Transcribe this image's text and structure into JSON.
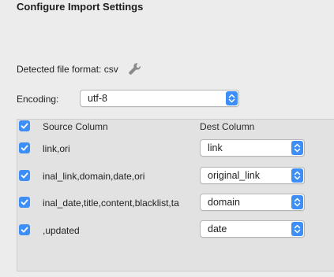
{
  "header": {
    "title": "Configure Import Settings"
  },
  "format": {
    "label": "Detected file format: csv",
    "icon": "wrench-icon"
  },
  "encoding": {
    "label": "Encoding:",
    "value": "utf-8"
  },
  "table": {
    "headers": {
      "source": "Source Column",
      "dest": "Dest Column"
    },
    "select_all_checked": true,
    "rows": [
      {
        "source": "link,ori",
        "dest": "link",
        "checked": true
      },
      {
        "source": "inal_link,domain,date,ori",
        "dest": "original_link",
        "checked": true
      },
      {
        "source": "inal_date,title,content,blacklist,ta",
        "dest": "domain",
        "checked": true
      },
      {
        "source": ",updated",
        "dest": "date",
        "checked": true
      }
    ]
  },
  "colors": {
    "accent": "#3d8ff7",
    "panel_bg": "#e2e2e2",
    "window_bg": "#ececec"
  }
}
